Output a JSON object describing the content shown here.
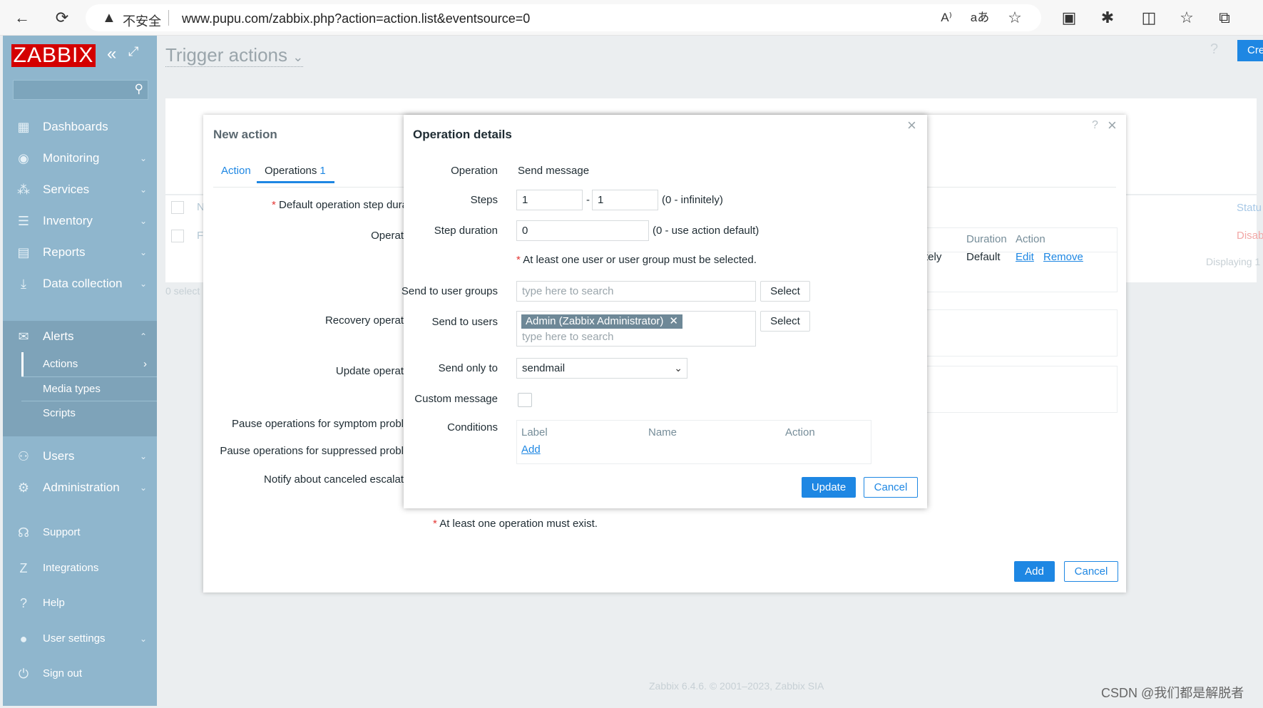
{
  "browser": {
    "insecure_label": "不安全",
    "url": "www.pupu.com/zabbix.php?action=action.list&eventsource=0",
    "back_icon": "←",
    "refresh_icon": "⟳",
    "warn_icon": "▲",
    "read_aloud_icon": "A⁾",
    "translate_icon": "aあ",
    "favorite_icon": "☆",
    "ext1_icon": "▣",
    "ext2_icon": "✱",
    "split_icon": "◫",
    "favorites_icon": "☆",
    "collections_icon": "⧉"
  },
  "sidebar": {
    "logo": "ZABBIX",
    "collapse_icon": "«",
    "kiosk_icon": "⤢",
    "search_icon": "⚲",
    "items": [
      {
        "label": "Dashboards",
        "icon": "▦"
      },
      {
        "label": "Monitoring",
        "icon": "◉",
        "chevron": "⌄"
      },
      {
        "label": "Services",
        "icon": "⁂",
        "chevron": "⌄"
      },
      {
        "label": "Inventory",
        "icon": "☰",
        "chevron": "⌄"
      },
      {
        "label": "Reports",
        "icon": "▤",
        "chevron": "⌄"
      },
      {
        "label": "Data collection",
        "icon": "⤓",
        "chevron": "⌄"
      },
      {
        "label": "Alerts",
        "icon": "✉",
        "chevron": "⌃"
      },
      {
        "label": "Users",
        "icon": "⚇",
        "chevron": "⌄"
      },
      {
        "label": "Administration",
        "icon": "⚙",
        "chevron": "⌄"
      }
    ],
    "alerts_sub": [
      {
        "label": "Actions",
        "chevron": "›"
      },
      {
        "label": "Media types"
      },
      {
        "label": "Scripts"
      }
    ],
    "bottom": [
      {
        "label": "Support",
        "icon": "☊"
      },
      {
        "label": "Integrations",
        "icon": "Z"
      },
      {
        "label": "Help",
        "icon": "?"
      },
      {
        "label": "User settings",
        "icon": "●",
        "chevron": "⌄"
      },
      {
        "label": "Sign out",
        "icon": "⏻"
      }
    ]
  },
  "header": {
    "title": "Trigger actions",
    "title_chevron": "⌄",
    "help": "?",
    "create_label": "Cre"
  },
  "background_list": {
    "col_status": "Statu",
    "row_status": "Disab",
    "displaying": "Displaying 1",
    "selected": "0 select",
    "col_name_stub": "N",
    "row_name_stub": "F"
  },
  "new_action": {
    "title": "New action",
    "help": "?",
    "close": "×",
    "tabs": {
      "action": "Action",
      "operations": "Operations",
      "operations_count": "1"
    },
    "labels": {
      "default_step": "Default operation step dura",
      "operations": "Operat",
      "recovery": "Recovery operat",
      "update": "Update operat",
      "pause_symptom": "Pause operations for symptom probl",
      "pause_suppressed": "Pause operations for suppressed probl",
      "notify_canceled": "Notify about canceled escalat"
    },
    "ops_table": {
      "col_duration": "Duration",
      "col_action": "Action",
      "row_start_stub": "tely",
      "row_duration": "Default",
      "row_edit": "Edit",
      "row_remove": "Remove"
    },
    "ops_must": "At least one operation must exist.",
    "add_label": "Add",
    "cancel_label": "Cancel"
  },
  "operation_details": {
    "title": "Operation details",
    "close": "×",
    "operation_label": "Operation",
    "operation_value": "Send message",
    "steps_label": "Steps",
    "steps_from": "1",
    "steps_to": "1",
    "steps_dash": "-",
    "steps_hint": "(0 - infinitely)",
    "step_duration_label": "Step duration",
    "step_duration_value": "0",
    "step_duration_hint": "(0 - use action default)",
    "user_required": "At least one user or user group must be selected.",
    "user_groups_label": "Send to user groups",
    "user_groups_placeholder": "type here to search",
    "select_label": "Select",
    "users_label": "Send to users",
    "user_token": "Admin (Zabbix Administrator)",
    "user_token_remove": "✕",
    "users_placeholder": "type here to search",
    "send_only_label": "Send only to",
    "send_only_value": "sendmail",
    "send_only_arrow": "⌄",
    "custom_message_label": "Custom message",
    "custom_message_checked": false,
    "conditions_label": "Conditions",
    "conditions_cols": [
      "Label",
      "Name",
      "Action"
    ],
    "conditions_add": "Add",
    "update_label": "Update",
    "cancel_label": "Cancel"
  },
  "footer": "Zabbix 6.4.6. © 2001–2023, Zabbix SIA",
  "watermark": "CSDN @我们都是解脱者",
  "colors": {
    "accent": "#1e87e3",
    "sidebar": "#8fb6cd",
    "logo": "#d40000",
    "required": "#e33734"
  }
}
